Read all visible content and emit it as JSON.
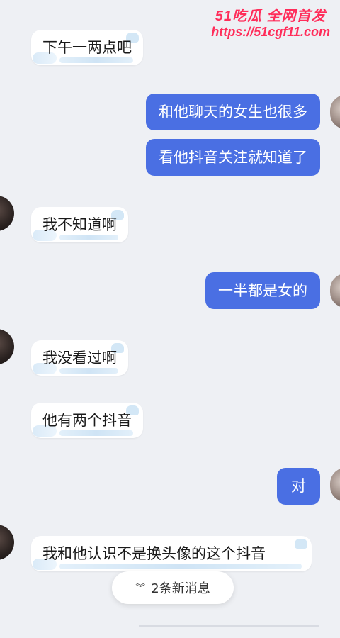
{
  "watermark": {
    "top": "51吃瓜 全网首发",
    "url": "https://51cgf11.com"
  },
  "messages": [
    {
      "side": "left",
      "text": "下午一两点吧"
    },
    {
      "side": "right",
      "text": "和他聊天的女生也很多"
    },
    {
      "side": "right",
      "text": "看他抖音关注就知道了"
    },
    {
      "side": "left",
      "text": "我不知道啊"
    },
    {
      "side": "right",
      "text": "一半都是女的"
    },
    {
      "side": "left",
      "text": "我没看过啊"
    },
    {
      "side": "left",
      "text": "他有两个抖音"
    },
    {
      "side": "right",
      "text": "对"
    },
    {
      "side": "left",
      "text": "我和他认识不是换头像的这个抖音"
    }
  ],
  "new_messages": {
    "label": "2条新消息",
    "icon": "double-chevron-down-icon"
  }
}
